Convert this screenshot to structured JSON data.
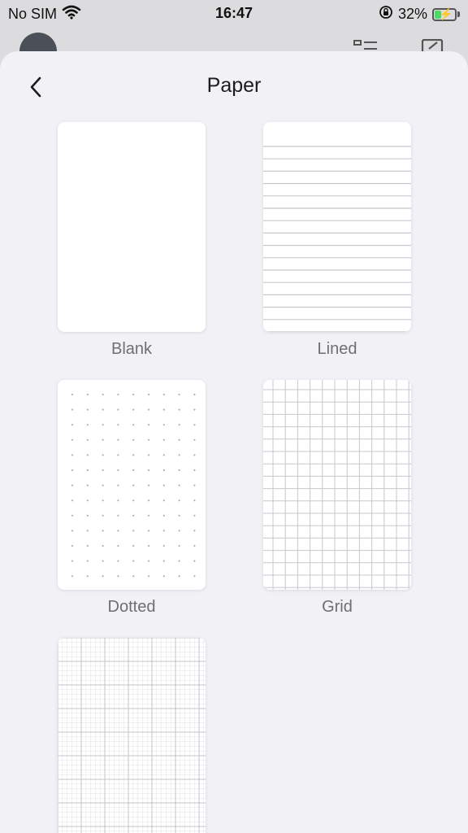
{
  "status_bar": {
    "carrier": "No SIM",
    "time": "16:47",
    "battery_percent": "32%",
    "battery_level": 0.32,
    "battery_color": "#4cd964"
  },
  "sheet": {
    "title": "Paper",
    "back_icon": "chevron-left-icon"
  },
  "papers": [
    {
      "label": "Blank",
      "pattern": "blank"
    },
    {
      "label": "Lined",
      "pattern": "lined"
    },
    {
      "label": "Dotted",
      "pattern": "dotted"
    },
    {
      "label": "Grid",
      "pattern": "grid"
    },
    {
      "label": "",
      "pattern": "graph"
    }
  ],
  "colors": {
    "sheet_background": "#f1f1f6",
    "card_background": "#ffffff",
    "label_text": "#6e6e73",
    "pattern_line": "#c8c8cc"
  }
}
